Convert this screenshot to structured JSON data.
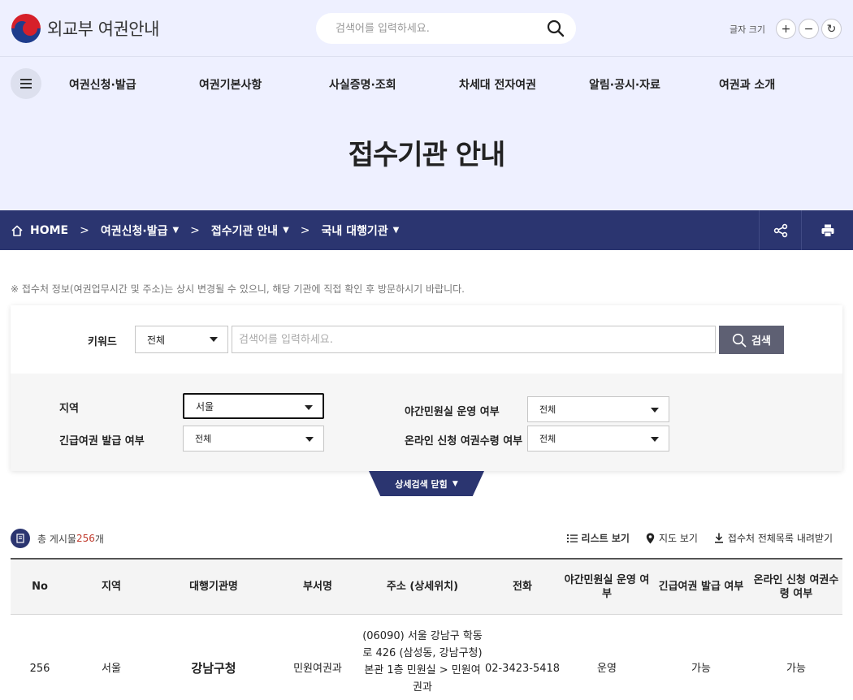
{
  "header": {
    "logo_text": "외교부 여권안내",
    "search_placeholder": "검색어를 입력하세요.",
    "font_size_label": "글자 크기",
    "font_plus": "+",
    "font_minus": "−",
    "font_reset": "↻"
  },
  "gnb": [
    "여권신청·발급",
    "여권기본사항",
    "사실증명·조회",
    "차세대 전자여권",
    "알림·공시·자료",
    "여권과 소개"
  ],
  "page_title": "접수기관 안내",
  "breadcrumb": {
    "home": "HOME",
    "items": [
      "여권신청·발급",
      "접수기관 안내",
      "국내 대행기관"
    ]
  },
  "notice": "※ 접수처 정보(여권업무시간 및 주소)는 상시 변경될 수 있으니, 해당 기관에 직접 확인 후 방문하시기 바랍니다.",
  "search": {
    "keyword_label": "키워드",
    "keyword_scope": "전체",
    "keyword_placeholder": "검색어를 입력하세요.",
    "search_button": "검색",
    "filters": {
      "region_label": "지역",
      "region_value": "서울",
      "night_label": "야간민원실 운영 여부",
      "night_value": "전체",
      "urgent_label": "긴급여권 발급 여부",
      "urgent_value": "전체",
      "online_label": "온라인 신청 여권수령 여부",
      "online_value": "전체"
    },
    "toggle_label": "상세검색 닫힘"
  },
  "results": {
    "total_prefix": "총 게시물 ",
    "total_count": "256",
    "total_suffix": "개",
    "list_view": "리스트 보기",
    "map_view": "지도 보기",
    "download": "접수처 전체목록 내려받기"
  },
  "table": {
    "headers": [
      "No",
      "지역",
      "대행기관명",
      "부서명",
      "주소 (상세위치)",
      "전화",
      "야간민원실 운영 여부",
      "긴급여권 발급 여부",
      "온라인 신청 여권수령 여부"
    ],
    "rows": [
      {
        "no": "256",
        "region": "서울",
        "agency": "강남구청",
        "dept": "민원여권과",
        "address": "(06090) 서울 강남구 학동로 426 (삼성동, 강남구청) 본관 1층 민원실 > 민원여권과",
        "phone": "02-3423-5418",
        "night": "운영",
        "urgent": "가능",
        "online": "가능"
      }
    ]
  },
  "colors": {
    "navy": "#2b3570",
    "hero_bg": "#eef0ff",
    "count_red": "#c0392b"
  }
}
